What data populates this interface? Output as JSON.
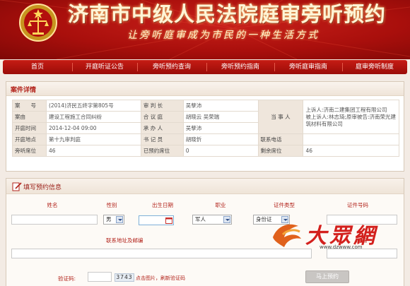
{
  "banner": {
    "title": "济南市中级人民法院庭审旁听预约",
    "slogan": "让旁听庭审成为市民的一种生活方式"
  },
  "nav": [
    "首页",
    "开庭听证公告",
    "旁听预约查询",
    "旁听预约指南",
    "旁听庭审指南",
    "庭审旁听制度"
  ],
  "case": {
    "header": "案件详情",
    "labels": {
      "case_no": "案　　号",
      "judge": "审 判 长",
      "cause": "案由",
      "panel": "合 议 庭",
      "party": "当 事 人",
      "time": "开庭时间",
      "handler": "承 办 人",
      "place": "开庭地点",
      "clerk": "书 记 员",
      "phone": "联系电话",
      "seats": "旁听席位",
      "booked": "已预约席位",
      "remain": "剩余席位"
    },
    "values": {
      "case_no": "(2014)济民五终字第805号",
      "judge": "吴孽沛",
      "cause": "建设工程施工合同纠纷",
      "panel": "胡晓云 吴荣瑞",
      "party_line1": "上诉人:济南二建集团工程有限公司",
      "party_line2": "被上诉人:林志琦;原审被告:济南荣光建筑材料有限公司",
      "time": "2014-12-04 09:00",
      "handler": "吴孽沛",
      "place": "第十九审判庭",
      "clerk": "胡晓忻",
      "phone": "",
      "seats": "46",
      "booked": "0",
      "remain": "46"
    }
  },
  "form": {
    "header": "填写预约信息",
    "columns": {
      "name": "姓名",
      "gender": "性别",
      "birth": "出生日期",
      "job": "职业",
      "id_type": "证件类型",
      "id_no": "证件号码"
    },
    "gender_value": "男",
    "job_value": "军人",
    "id_type_value": "身份证",
    "address_label": "联系地址及邮编",
    "zip_label": "邮编",
    "captcha_label": "验证码:",
    "captcha_text": "3743",
    "captcha_tip": "点击图片，刷新验证码",
    "submit": "马上预约"
  },
  "watermark": {
    "url": "www.dzwww.com"
  },
  "colors": {
    "accent_red": "#b3241c",
    "nav_red": "#b3160f",
    "label_bg": "#efe6dc"
  }
}
